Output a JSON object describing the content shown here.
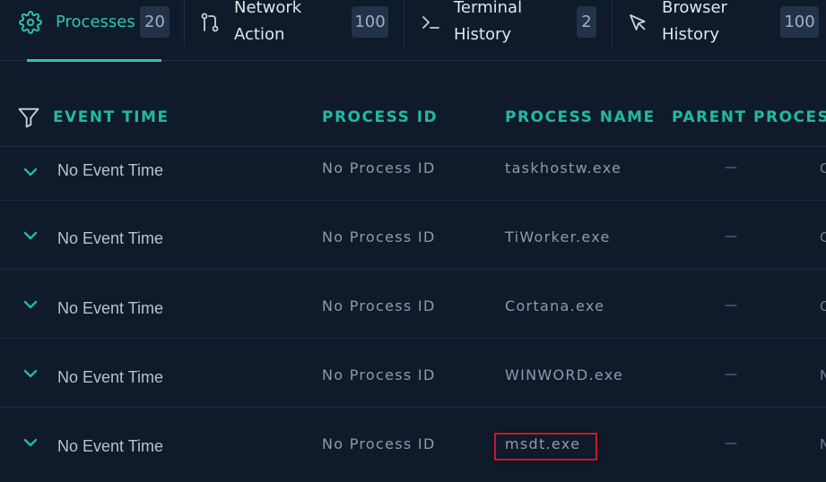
{
  "tabs": [
    {
      "label": "Processes",
      "badge": "20",
      "icon": "gear-icon",
      "active": true
    },
    {
      "label": "Network Action",
      "badge": "100",
      "icon": "git-pull-request-icon",
      "active": false
    },
    {
      "label": "Terminal History",
      "badge": "2",
      "icon": "terminal-prompt-icon",
      "active": false
    },
    {
      "label": "Browser History",
      "badge": "100",
      "icon": "cursor-icon",
      "active": false
    }
  ],
  "table": {
    "headers": {
      "event_time": "EVENT TIME",
      "process_id": "PROCESS ID",
      "process_name": "PROCESS NAME",
      "parent_process": "PARENT PROCESS"
    },
    "rows": [
      {
        "event_time": "No Event Time",
        "process_id": "No Process ID",
        "process_name": "taskhostw.exe",
        "parent": "—",
        "next_col": "C"
      },
      {
        "event_time": "No Event Time",
        "process_id": "No Process ID",
        "process_name": "TiWorker.exe",
        "parent": "—",
        "next_col": "C"
      },
      {
        "event_time": "No Event Time",
        "process_id": "No Process ID",
        "process_name": "Cortana.exe",
        "parent": "—",
        "next_col": "C"
      },
      {
        "event_time": "No Event Time",
        "process_id": "No Process ID",
        "process_name": "WINWORD.exe",
        "parent": "—",
        "next_col": "N"
      },
      {
        "event_time": "No Event Time",
        "process_id": "No Process ID",
        "process_name": "msdt.exe",
        "parent": "—",
        "next_col": "N"
      }
    ]
  },
  "colors": {
    "accent": "#2ec4b6",
    "background": "#0f1a2b",
    "highlight_box": "#c8192a"
  }
}
